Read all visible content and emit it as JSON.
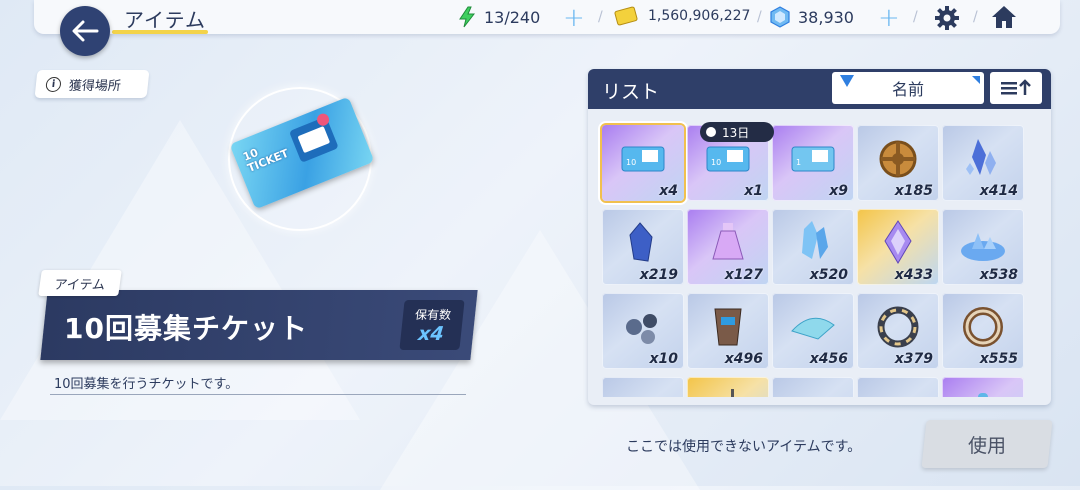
{
  "header": {
    "title": "アイテム",
    "stamina": "13/240",
    "gold": "1,560,906,227",
    "gems": "38,930"
  },
  "left": {
    "acquire_label": "獲得場所",
    "type_tag": "アイテム",
    "item_name": "10回募集チケット",
    "owned_label": "保有数",
    "owned_count": "x4",
    "description": "10回募集を行うチケットです。",
    "ticket_text": "10 TICKET"
  },
  "list": {
    "title": "リスト",
    "sort_label": "名前",
    "timer": "13日",
    "items": [
      {
        "qty": "x4",
        "icon": "ticket-10-icon",
        "rarity": "purple"
      },
      {
        "qty": "x1",
        "icon": "ticket-10-icon",
        "rarity": "purple"
      },
      {
        "qty": "x9",
        "icon": "ticket-1-icon",
        "rarity": "purple"
      },
      {
        "qty": "x185",
        "icon": "bronze-wheel-icon",
        "rarity": "blue"
      },
      {
        "qty": "x414",
        "icon": "crystal-shards-icon",
        "rarity": "blue"
      },
      {
        "qty": "x219",
        "icon": "blue-crystal-icon",
        "rarity": "blue"
      },
      {
        "qty": "x127",
        "icon": "potion-bottle-icon",
        "rarity": "purple"
      },
      {
        "qty": "x520",
        "icon": "crystal-cluster-icon",
        "rarity": "blue"
      },
      {
        "qty": "x433",
        "icon": "gem-prism-icon",
        "rarity": "gold"
      },
      {
        "qty": "x538",
        "icon": "crystal-pile-icon",
        "rarity": "blue"
      },
      {
        "qty": "x10",
        "icon": "metal-parts-icon",
        "rarity": "blue"
      },
      {
        "qty": "x496",
        "icon": "armor-piece-icon",
        "rarity": "blue"
      },
      {
        "qty": "x456",
        "icon": "ice-shard-icon",
        "rarity": "blue"
      },
      {
        "qty": "x379",
        "icon": "gear-ring-icon",
        "rarity": "blue"
      },
      {
        "qty": "x555",
        "icon": "bronze-ring-icon",
        "rarity": "blue"
      },
      {
        "qty": "",
        "icon": "card-icon",
        "rarity": "blue"
      },
      {
        "qty": "",
        "icon": "juice-box-icon",
        "rarity": "gold"
      },
      {
        "qty": "",
        "icon": "plant-pot-icon",
        "rarity": "blue"
      },
      {
        "qty": "",
        "icon": "green-item-icon",
        "rarity": "blue"
      },
      {
        "qty": "",
        "icon": "purple-item-icon",
        "rarity": "purple"
      }
    ]
  },
  "footer": {
    "cannot_use": "ここでは使用できないアイテムです。",
    "use_label": "使用"
  },
  "colors": {
    "navy": "#2f3f69",
    "accent_blue": "#2f7fe0",
    "highlight_gold": "#f1c04e"
  }
}
